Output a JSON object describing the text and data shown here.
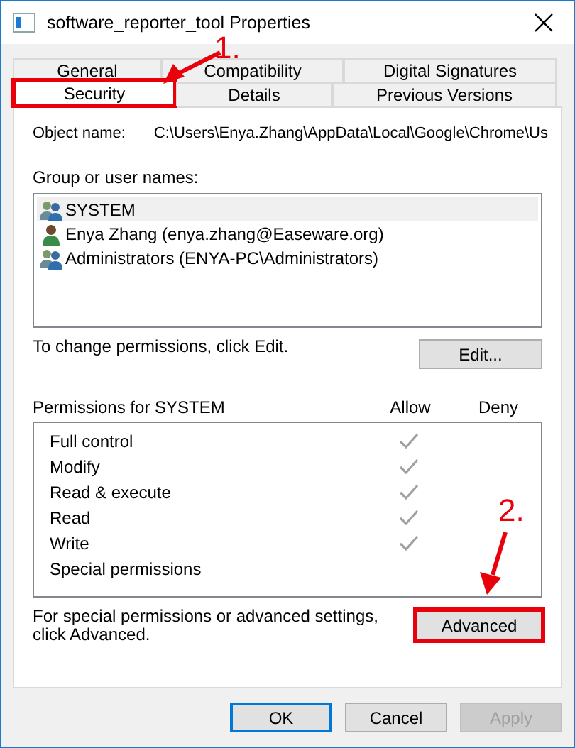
{
  "window": {
    "title": "software_reporter_tool Properties"
  },
  "tab_rows": [
    [
      {
        "label": "General",
        "selected": false,
        "highlighted": false
      },
      {
        "label": "Compatibility",
        "selected": false,
        "highlighted": false
      },
      {
        "label": "Digital Signatures",
        "selected": false,
        "highlighted": false
      }
    ],
    [
      {
        "label": "Security",
        "selected": true,
        "highlighted": true
      },
      {
        "label": "Details",
        "selected": false,
        "highlighted": false
      },
      {
        "label": "Previous Versions",
        "selected": false,
        "highlighted": false
      }
    ]
  ],
  "object_name": {
    "label": "Object name:",
    "value": "C:\\Users\\Enya.Zhang\\AppData\\Local\\Google\\Chrome\\Us"
  },
  "groups": {
    "label": "Group or user names:",
    "items": [
      {
        "kind": "group",
        "name": "SYSTEM",
        "selected": true
      },
      {
        "kind": "user",
        "name": "Enya Zhang (enya.zhang@Easeware.org)",
        "selected": false
      },
      {
        "kind": "group",
        "name": "Administrators (ENYA-PC\\Administrators)",
        "selected": false
      }
    ]
  },
  "edit_hint": "To change permissions, click Edit.",
  "edit_button": {
    "label": "Edit..."
  },
  "permissions": {
    "label": "Permissions for SYSTEM",
    "allow_label": "Allow",
    "deny_label": "Deny",
    "rows": [
      {
        "name": "Full control",
        "allow": true,
        "deny": false
      },
      {
        "name": "Modify",
        "allow": true,
        "deny": false
      },
      {
        "name": "Read & execute",
        "allow": true,
        "deny": false
      },
      {
        "name": "Read",
        "allow": true,
        "deny": false
      },
      {
        "name": "Write",
        "allow": true,
        "deny": false
      },
      {
        "name": "Special permissions",
        "allow": false,
        "deny": false
      }
    ]
  },
  "advanced_hint": "For special permissions or advanced settings, click Advanced.",
  "advanced_button": {
    "label": "Advanced",
    "highlighted": true
  },
  "buttons": [
    {
      "label": "OK",
      "kind": "default",
      "disabled": false
    },
    {
      "label": "Cancel",
      "kind": "normal",
      "disabled": false
    },
    {
      "label": "Apply",
      "kind": "normal",
      "disabled": true
    }
  ],
  "annotations": [
    {
      "label": "1."
    },
    {
      "label": "2."
    }
  ]
}
